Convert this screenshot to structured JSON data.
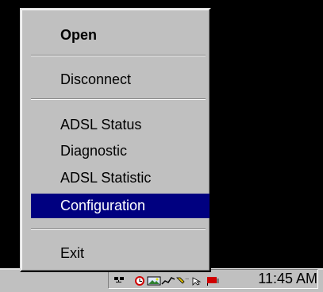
{
  "menu": {
    "items": [
      {
        "label": "Open",
        "bold": true
      },
      {
        "label": "Disconnect"
      },
      {
        "label": "ADSL Status"
      },
      {
        "label": "Diagnostic"
      },
      {
        "label": "ADSL Statistic"
      },
      {
        "label": "Configuration",
        "selected": true
      },
      {
        "label": "Exit"
      }
    ]
  },
  "tray": {
    "clock": "11:45 AM",
    "icons": [
      "network-icon",
      "clock-icon",
      "image-icon",
      "graph-icon",
      "tool-icon",
      "flag-icon"
    ]
  },
  "colors": {
    "menu_bg": "#c0c0c0",
    "selection_bg": "#000080",
    "selection_fg": "#ffffff",
    "desktop_bg": "#000000"
  }
}
